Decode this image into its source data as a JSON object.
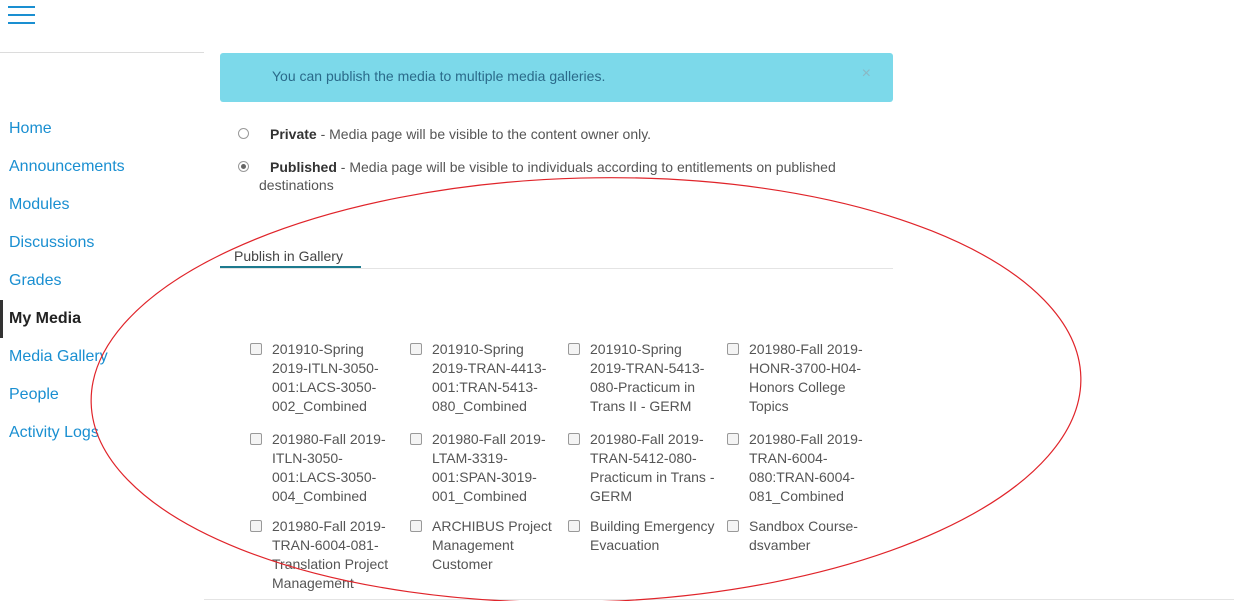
{
  "nav": {
    "items": [
      {
        "label": "Home",
        "active": false
      },
      {
        "label": "Announcements",
        "active": false
      },
      {
        "label": "Modules",
        "active": false
      },
      {
        "label": "Discussions",
        "active": false
      },
      {
        "label": "Grades",
        "active": false
      },
      {
        "label": "My Media",
        "active": true
      },
      {
        "label": "Media Gallery",
        "active": false
      },
      {
        "label": "People",
        "active": false
      },
      {
        "label": "Activity Logs",
        "active": false
      }
    ]
  },
  "alert": {
    "message": "You can publish the media to multiple media galleries.",
    "close": "×"
  },
  "visibility": {
    "private": {
      "title": "Private",
      "desc": " - Media page will be visible to the content owner only.",
      "checked": false
    },
    "published": {
      "title": "Published",
      "desc": " - Media page will be visible to individuals according to entitlements on published",
      "desc_cont": "destinations",
      "checked": true
    }
  },
  "tab": {
    "label": "Publish in Gallery"
  },
  "galleries": [
    {
      "label": "201910-Spring 2019-ITLN-3050-001:LACS-3050-002_Combined",
      "checked": false
    },
    {
      "label": "201910-Spring 2019-TRAN-4413-001:TRAN-5413-080_Combined",
      "checked": false
    },
    {
      "label": "201910-Spring 2019-TRAN-5413-080-Practicum in Trans II - GERM",
      "checked": false
    },
    {
      "label": "201980-Fall 2019-HONR-3700-H04-Honors College Topics",
      "checked": false
    },
    {
      "label": "201980-Fall 2019-ITLN-3050-001:LACS-3050-004_Combined",
      "checked": false
    },
    {
      "label": "201980-Fall 2019-LTAM-3319-001:SPAN-3019-001_Combined",
      "checked": false
    },
    {
      "label": "201980-Fall 2019-TRAN-5412-080-Practicum in Trans - GERM",
      "checked": false
    },
    {
      "label": "201980-Fall 2019-TRAN-6004-080:TRAN-6004-081_Combined",
      "checked": false
    },
    {
      "label": "201980-Fall 2019-TRAN-6004-081-Translation Project Management",
      "checked": false
    },
    {
      "label": "ARCHIBUS Project Management Customer",
      "checked": false
    },
    {
      "label": "Building Emergency Evacuation",
      "checked": false
    },
    {
      "label": "Sandbox Course-dsvamber",
      "checked": false
    }
  ],
  "colors": {
    "link": "#1a8fd1",
    "alert_bg": "#7cd9ea",
    "tab_underline": "#1d7a8e",
    "annotation": "#e0242a"
  }
}
